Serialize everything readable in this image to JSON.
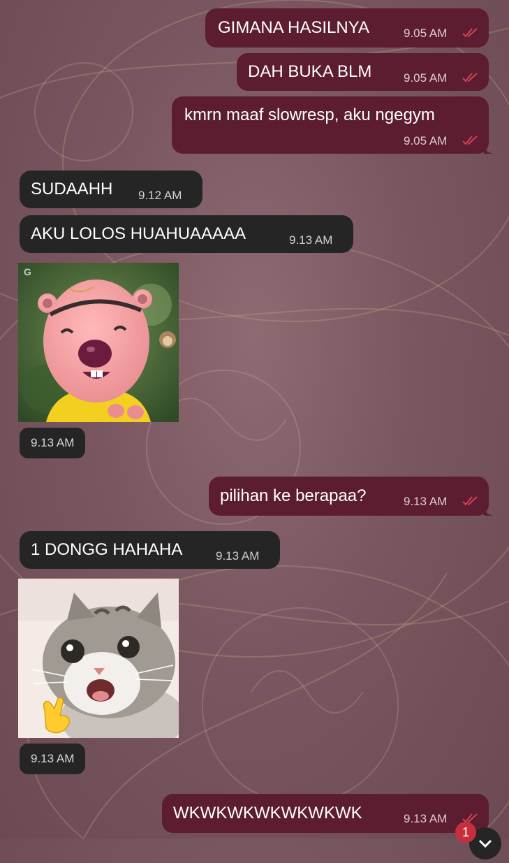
{
  "messages": [
    {
      "dir": "out",
      "text": "GIMANA HASILNYA",
      "time": "9.05 AM"
    },
    {
      "dir": "out",
      "text": "DAH BUKA BLM",
      "time": "9.05 AM"
    },
    {
      "dir": "out",
      "text": "kmrn maaf slowresp, aku ngegym",
      "time": "9.05 AM"
    },
    {
      "dir": "in",
      "text": "SUDAAHH",
      "time": "9.12 AM"
    },
    {
      "dir": "in",
      "text": "AKU LOLOS HUAHUAAAAA",
      "time": "9.13 AM"
    },
    {
      "dir": "in",
      "type": "sticker",
      "sticker": "cartoon-beaver-sticker",
      "time": "9.13 AM"
    },
    {
      "dir": "out",
      "text": "pilihan ke berapaa?",
      "time": "9.13 AM"
    },
    {
      "dir": "in",
      "text": "1 DONGG HAHAHA",
      "time": "9.13 AM"
    },
    {
      "dir": "in",
      "type": "sticker",
      "sticker": "cat-shaka-sticker",
      "time": "9.13 AM"
    },
    {
      "dir": "out",
      "text": "WKWKWKWKWKWKWK",
      "time": "9.13 AM"
    }
  ],
  "unread_badge": "1",
  "icons": {
    "read_receipt": "double-check-icon",
    "scroll_down": "chevron-down-icon"
  },
  "colors": {
    "outgoing_bubble": "#5d1d31",
    "incoming_bubble": "#262526",
    "read_tick": "#d1434f",
    "wallpaper": "#7a5760",
    "badge": "#c62f3c"
  }
}
